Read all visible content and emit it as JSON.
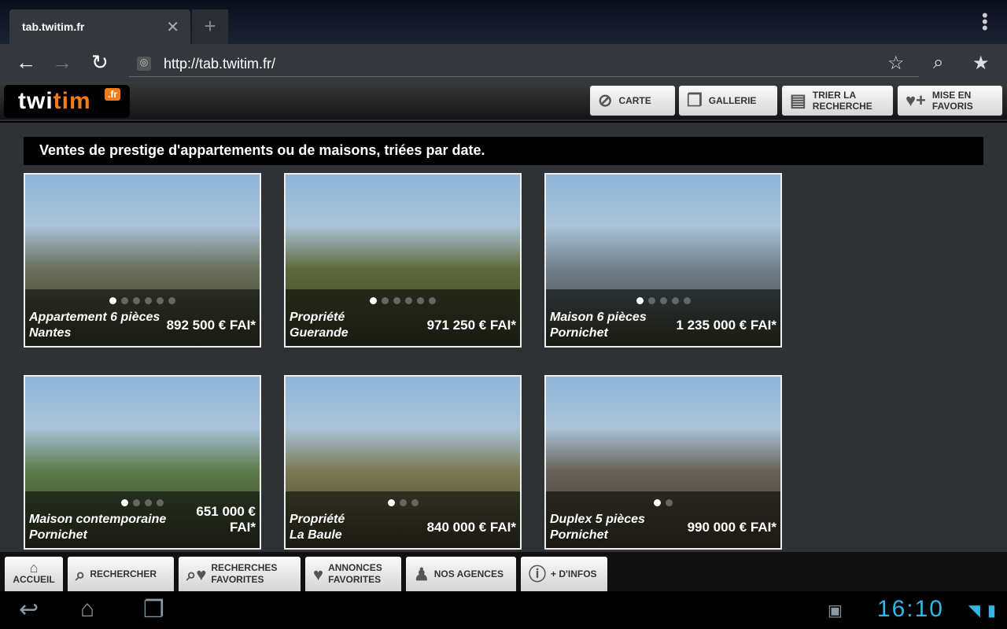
{
  "browser": {
    "tab_title": "tab.twitim.fr",
    "url": "http://tab.twitim.fr/"
  },
  "header": {
    "logo": "twitim.fr",
    "logo_parts": {
      "a": "twi",
      "b": "tim",
      "c": ".fr"
    },
    "buttons": [
      {
        "label": "CARTE",
        "icon": "compass-icon"
      },
      {
        "label": "GALLERIE",
        "icon": "gallery-icon"
      },
      {
        "label": "TRIER LA RECHERCHE",
        "icon": "inbox-icon"
      },
      {
        "label": "MISE EN FAVORIS",
        "icon": "heart-plus-icon"
      }
    ]
  },
  "main": {
    "banner": "Ventes de prestige d'appartements ou de maisons, triées par date.",
    "listings": [
      {
        "title": "Appartement 6 pièces",
        "city": "Nantes",
        "price": "892 500 € FAI*",
        "photos": 6,
        "img": "#6a6e5a"
      },
      {
        "title": "Propriété",
        "city": "Guerande",
        "price": "971 250 € FAI*",
        "photos": 6,
        "img": "#5f6a3a"
      },
      {
        "title": "Maison 6 pièces",
        "city": "Pornichet",
        "price": "1 235 000 € FAI*",
        "photos": 5,
        "img": "#6f7f8a"
      },
      {
        "title": "Maison contemporaine",
        "city": "Pornichet",
        "price": "651 000 € FAI*",
        "photos": 4,
        "img": "#5c7a4a"
      },
      {
        "title": "Propriété",
        "city": "La Baule",
        "price": "840 000 € FAI*",
        "photos": 3,
        "img": "#7a7a55"
      },
      {
        "title": "Duplex 5 pièces",
        "city": "Pornichet",
        "price": "990 000 € FAI*",
        "photos": 2,
        "img": "#6a625a"
      }
    ]
  },
  "bottom_nav": [
    {
      "label": "ACCUEIL",
      "icon": "home-icon"
    },
    {
      "label": "RECHERCHER",
      "icon": "search-icon"
    },
    {
      "label": "RECHERCHES FAVORITES",
      "icon": "search-heart-icon"
    },
    {
      "label": "ANNONCES FAVORITES",
      "icon": "heart-icon"
    },
    {
      "label": "NOS AGENCES",
      "icon": "agent-icon"
    },
    {
      "label": "+ D'INFOS",
      "icon": "info-icon"
    }
  ],
  "system": {
    "time": "16:10"
  }
}
